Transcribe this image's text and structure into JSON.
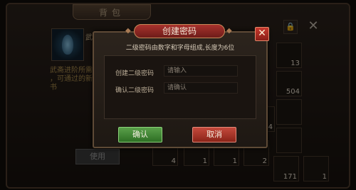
{
  "bag": {
    "title": "背包",
    "close_glyph": "✕",
    "lock_icon": "lock-icon",
    "item_name_fragment": "武",
    "desc_lines": [
      "武斋进阶所需",
      "，可通过的新书"
    ],
    "use_label": "使用",
    "slot_counts": [
      "13",
      "504",
      "44",
      "4",
      "1",
      "1",
      "2",
      "171",
      "1"
    ]
  },
  "dialog": {
    "title": "创建密码",
    "hint": "二级密码由数字和字母组成,长度为6位",
    "create_label": "创建二级密码",
    "create_placeholder": "请输入",
    "confirm_label": "确认二级密码",
    "confirm_placeholder": "请确认",
    "ok_label": "确认",
    "cancel_label": "取消",
    "close_glyph": "✕",
    "close_icon": "close-icon"
  },
  "colors": {
    "title_plate": "#8a2621",
    "confirm_button": "#3e8a32",
    "cancel_button": "#b23a2e"
  }
}
